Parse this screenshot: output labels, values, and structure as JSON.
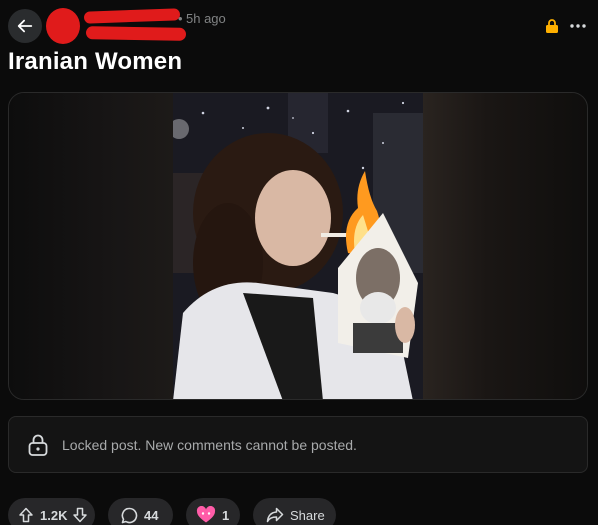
{
  "header": {
    "timestamp": "5h ago",
    "separator": "•",
    "icons": {
      "back": "arrow-left-icon",
      "lock": "lock-icon",
      "more": "more-horizontal-icon"
    }
  },
  "post": {
    "title": "Iranian Women"
  },
  "locked_notice": {
    "text": "Locked post. New comments cannot be posted."
  },
  "actions": {
    "votes": "1.2K",
    "comments": "44",
    "awards": "1",
    "share": "Share"
  },
  "colors": {
    "background": "#0b0b0b",
    "redaction": "#e01b1b",
    "lock_accent": "#ffb000"
  }
}
